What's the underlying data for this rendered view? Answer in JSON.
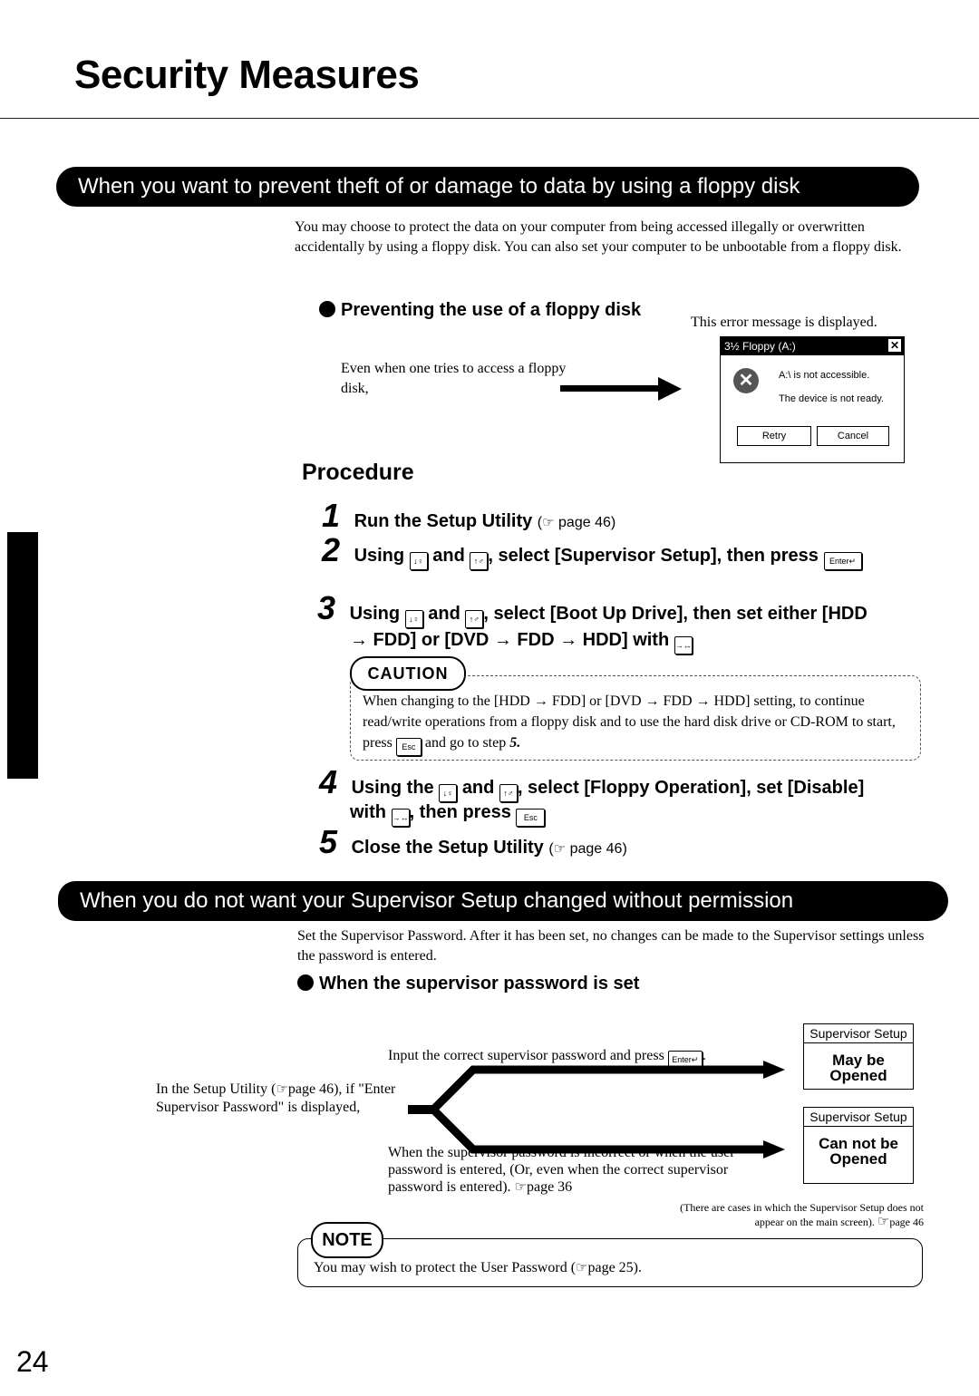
{
  "page": {
    "title": "Security Measures",
    "page_number": "24"
  },
  "section1": {
    "banner": "When you want to prevent theft of or damage to data by using a floppy disk",
    "intro": "You may choose to protect the data on your computer from being accessed illegally or overwritten accidentally by using a floppy disk.  You can also set your computer to be unbootable from a floppy disk.",
    "subheading": "Preventing the use of a floppy disk",
    "error_caption": "This error message is displayed.",
    "access_text": "Even when one tries to access a floppy disk,",
    "dialog": {
      "title": "3½ Floppy (A:)",
      "close_glyph": "✕",
      "icon_glyph": "✕",
      "message1": "A:\\ is not accessible.",
      "message2": "The device is not ready.",
      "retry_label": "Retry",
      "cancel_label": "Cancel"
    },
    "procedure_title": "Procedure",
    "steps": [
      {
        "num": "1",
        "text": "Run the Setup Utility",
        "ref": "page 46"
      },
      {
        "num": "2",
        "text_a": "Using",
        "and": "and",
        "text_b": ", select [Supervisor Setup], then press"
      },
      {
        "num": "3",
        "text_a": "Using",
        "and": "and",
        "text_b": ", select [Boot Up Drive], then set either [HDD",
        "line2": "→ FDD] or [DVD → FDD → HDD] with"
      },
      {
        "num": "4",
        "text_a": "Using the",
        "and": "and",
        "text_b": ", select [Floppy Operation], set [Disable]",
        "line2_a": "with",
        "line2_b": ", then press"
      },
      {
        "num": "5",
        "text": "Close the Setup Utility",
        "ref": "page 46"
      }
    ],
    "caution": {
      "label": "CAUTION",
      "text_before": "When changing to the [HDD → FDD] or [DVD → FDD → HDD] setting, to continue read/write operations from a floppy disk and to use the hard disk drive or CD-ROM to start, press",
      "text_after": "and go to step",
      "step_ref": "5."
    }
  },
  "keys": {
    "down": "↓♀",
    "up": "↑♂",
    "enter": "Enter↵",
    "esc": "Esc",
    "change": "→↔"
  },
  "section2": {
    "banner": "When you do not want your Supervisor Setup changed without permission",
    "intro": "Set the Supervisor Password.  After it has been set, no changes can be made to the Supervisor settings unless the password is entered.",
    "subheading": "When the supervisor password is set",
    "left_text_a": "In the Setup Utility (",
    "left_ref": "page 46),",
    "left_text_b": "if \"Enter Supervisor Password\" is displayed,",
    "upper_text": "Input the correct supervisor password and press",
    "lower_text": "When the supervisor password is incorrect or when the user password is entered, (Or, even when the correct supervisor password is entered).",
    "lower_ref": "page 36",
    "box1": {
      "header": "Supervisor Setup",
      "body": "May be Opened"
    },
    "box2": {
      "header": "Supervisor Setup",
      "body": "Can not be Opened"
    },
    "footnote": "(There are cases in which the Supervisor Setup does not appear on the main screen).",
    "footnote_ref": "page 46"
  },
  "note": {
    "label": "NOTE",
    "text": "You may wish to protect the User Password (",
    "ref": "page 25)."
  },
  "icons": {
    "pointing_hand": "☞"
  }
}
